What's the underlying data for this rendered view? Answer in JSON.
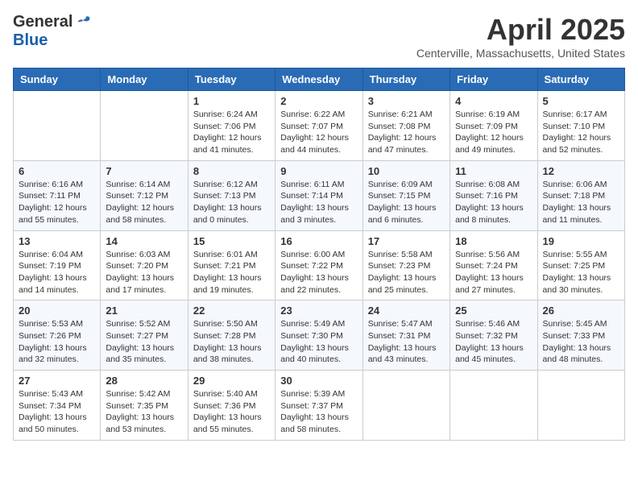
{
  "header": {
    "logo_general": "General",
    "logo_blue": "Blue",
    "month_title": "April 2025",
    "subtitle": "Centerville, Massachusetts, United States"
  },
  "days_of_week": [
    "Sunday",
    "Monday",
    "Tuesday",
    "Wednesday",
    "Thursday",
    "Friday",
    "Saturday"
  ],
  "weeks": [
    [
      {
        "day": "",
        "info": ""
      },
      {
        "day": "",
        "info": ""
      },
      {
        "day": "1",
        "info": "Sunrise: 6:24 AM\nSunset: 7:06 PM\nDaylight: 12 hours and 41 minutes."
      },
      {
        "day": "2",
        "info": "Sunrise: 6:22 AM\nSunset: 7:07 PM\nDaylight: 12 hours and 44 minutes."
      },
      {
        "day": "3",
        "info": "Sunrise: 6:21 AM\nSunset: 7:08 PM\nDaylight: 12 hours and 47 minutes."
      },
      {
        "day": "4",
        "info": "Sunrise: 6:19 AM\nSunset: 7:09 PM\nDaylight: 12 hours and 49 minutes."
      },
      {
        "day": "5",
        "info": "Sunrise: 6:17 AM\nSunset: 7:10 PM\nDaylight: 12 hours and 52 minutes."
      }
    ],
    [
      {
        "day": "6",
        "info": "Sunrise: 6:16 AM\nSunset: 7:11 PM\nDaylight: 12 hours and 55 minutes."
      },
      {
        "day": "7",
        "info": "Sunrise: 6:14 AM\nSunset: 7:12 PM\nDaylight: 12 hours and 58 minutes."
      },
      {
        "day": "8",
        "info": "Sunrise: 6:12 AM\nSunset: 7:13 PM\nDaylight: 13 hours and 0 minutes."
      },
      {
        "day": "9",
        "info": "Sunrise: 6:11 AM\nSunset: 7:14 PM\nDaylight: 13 hours and 3 minutes."
      },
      {
        "day": "10",
        "info": "Sunrise: 6:09 AM\nSunset: 7:15 PM\nDaylight: 13 hours and 6 minutes."
      },
      {
        "day": "11",
        "info": "Sunrise: 6:08 AM\nSunset: 7:16 PM\nDaylight: 13 hours and 8 minutes."
      },
      {
        "day": "12",
        "info": "Sunrise: 6:06 AM\nSunset: 7:18 PM\nDaylight: 13 hours and 11 minutes."
      }
    ],
    [
      {
        "day": "13",
        "info": "Sunrise: 6:04 AM\nSunset: 7:19 PM\nDaylight: 13 hours and 14 minutes."
      },
      {
        "day": "14",
        "info": "Sunrise: 6:03 AM\nSunset: 7:20 PM\nDaylight: 13 hours and 17 minutes."
      },
      {
        "day": "15",
        "info": "Sunrise: 6:01 AM\nSunset: 7:21 PM\nDaylight: 13 hours and 19 minutes."
      },
      {
        "day": "16",
        "info": "Sunrise: 6:00 AM\nSunset: 7:22 PM\nDaylight: 13 hours and 22 minutes."
      },
      {
        "day": "17",
        "info": "Sunrise: 5:58 AM\nSunset: 7:23 PM\nDaylight: 13 hours and 25 minutes."
      },
      {
        "day": "18",
        "info": "Sunrise: 5:56 AM\nSunset: 7:24 PM\nDaylight: 13 hours and 27 minutes."
      },
      {
        "day": "19",
        "info": "Sunrise: 5:55 AM\nSunset: 7:25 PM\nDaylight: 13 hours and 30 minutes."
      }
    ],
    [
      {
        "day": "20",
        "info": "Sunrise: 5:53 AM\nSunset: 7:26 PM\nDaylight: 13 hours and 32 minutes."
      },
      {
        "day": "21",
        "info": "Sunrise: 5:52 AM\nSunset: 7:27 PM\nDaylight: 13 hours and 35 minutes."
      },
      {
        "day": "22",
        "info": "Sunrise: 5:50 AM\nSunset: 7:28 PM\nDaylight: 13 hours and 38 minutes."
      },
      {
        "day": "23",
        "info": "Sunrise: 5:49 AM\nSunset: 7:30 PM\nDaylight: 13 hours and 40 minutes."
      },
      {
        "day": "24",
        "info": "Sunrise: 5:47 AM\nSunset: 7:31 PM\nDaylight: 13 hours and 43 minutes."
      },
      {
        "day": "25",
        "info": "Sunrise: 5:46 AM\nSunset: 7:32 PM\nDaylight: 13 hours and 45 minutes."
      },
      {
        "day": "26",
        "info": "Sunrise: 5:45 AM\nSunset: 7:33 PM\nDaylight: 13 hours and 48 minutes."
      }
    ],
    [
      {
        "day": "27",
        "info": "Sunrise: 5:43 AM\nSunset: 7:34 PM\nDaylight: 13 hours and 50 minutes."
      },
      {
        "day": "28",
        "info": "Sunrise: 5:42 AM\nSunset: 7:35 PM\nDaylight: 13 hours and 53 minutes."
      },
      {
        "day": "29",
        "info": "Sunrise: 5:40 AM\nSunset: 7:36 PM\nDaylight: 13 hours and 55 minutes."
      },
      {
        "day": "30",
        "info": "Sunrise: 5:39 AM\nSunset: 7:37 PM\nDaylight: 13 hours and 58 minutes."
      },
      {
        "day": "",
        "info": ""
      },
      {
        "day": "",
        "info": ""
      },
      {
        "day": "",
        "info": ""
      }
    ]
  ]
}
